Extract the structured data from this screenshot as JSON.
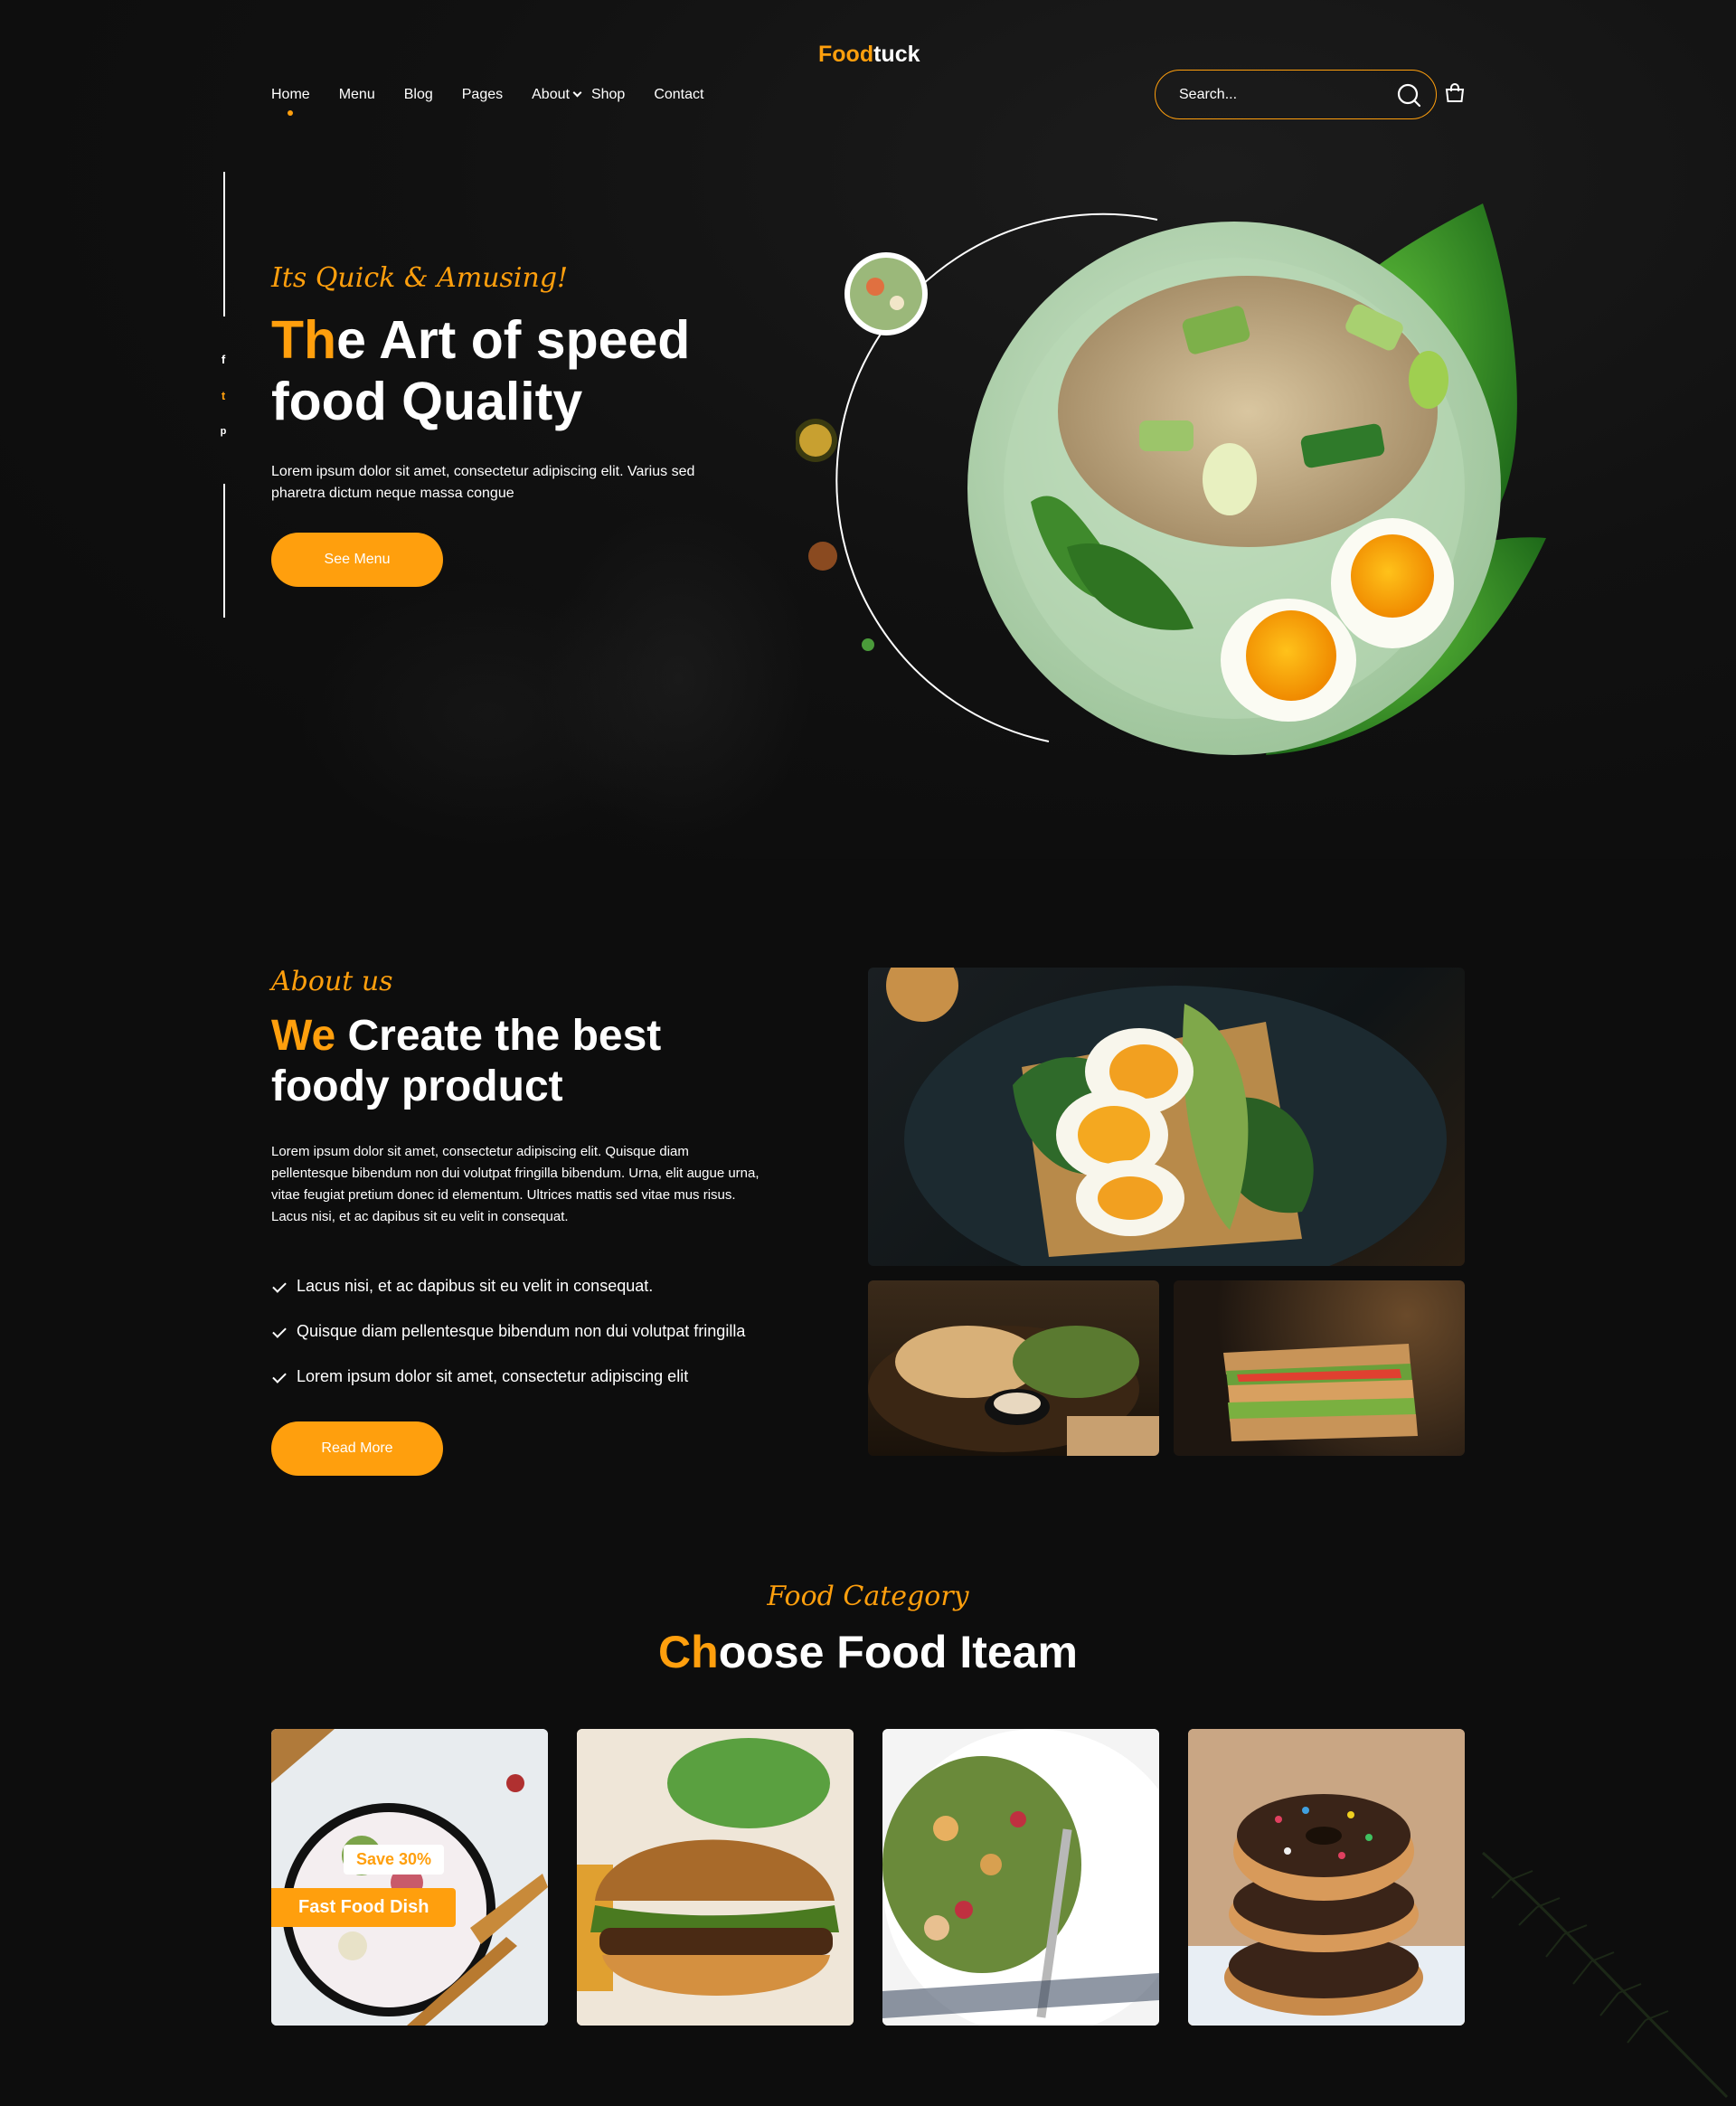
{
  "brand": {
    "name_part1": "Food",
    "name_part2": "tuck",
    "accent": "#ff9f0d"
  },
  "nav": {
    "items": [
      {
        "label": "Home",
        "active": true
      },
      {
        "label": "Menu"
      },
      {
        "label": "Blog"
      },
      {
        "label": "Pages"
      },
      {
        "label": "About",
        "dropdown": true
      },
      {
        "label": "Shop"
      },
      {
        "label": "Contact"
      }
    ]
  },
  "search": {
    "placeholder": "Search...",
    "icon": "search-icon"
  },
  "cart": {
    "icon": "shopping-bag-icon"
  },
  "social": [
    {
      "icon": "facebook-icon",
      "glyph": "f"
    },
    {
      "icon": "twitter-icon",
      "glyph": "t"
    },
    {
      "icon": "pinterest-icon",
      "glyph": "p"
    }
  ],
  "hero": {
    "tagline": "Its Quick & Amusing!",
    "title_highlight": "Th",
    "title_rest_line1": "e Art of speed",
    "title_line2": "food Quality",
    "description": "Lorem ipsum dolor sit amet, consectetur adipiscing elit. Varius sed pharetra dictum neque massa congue",
    "button_label": "See Menu"
  },
  "about": {
    "tagline": "About us",
    "title_highlight": "We",
    "title_rest_line1": " Create the best",
    "title_line2": "foody product",
    "description": "Lorem ipsum dolor sit amet, consectetur adipiscing elit. Quisque diam pellentesque bibendum non dui volutpat fringilla bibendum. Urna, elit augue urna, vitae feugiat pretium donec id elementum. Ultrices mattis sed vitae mus risus. Lacus nisi, et ac dapibus sit eu velit in consequat.",
    "checklist": [
      "Lacus nisi, et ac dapibus sit eu velit in consequat.",
      "Quisque diam pellentesque bibendum non dui volutpat fringilla",
      "Lorem ipsum dolor sit amet, consectetur adipiscing elit"
    ],
    "button_label": "Read More"
  },
  "category": {
    "tagline": "Food Category",
    "title_highlight": "Ch",
    "title_rest": "oose Food Iteam",
    "cards": [
      {
        "badge_save": "Save 30%",
        "badge_name": "Fast Food Dish"
      },
      {},
      {},
      {}
    ]
  }
}
